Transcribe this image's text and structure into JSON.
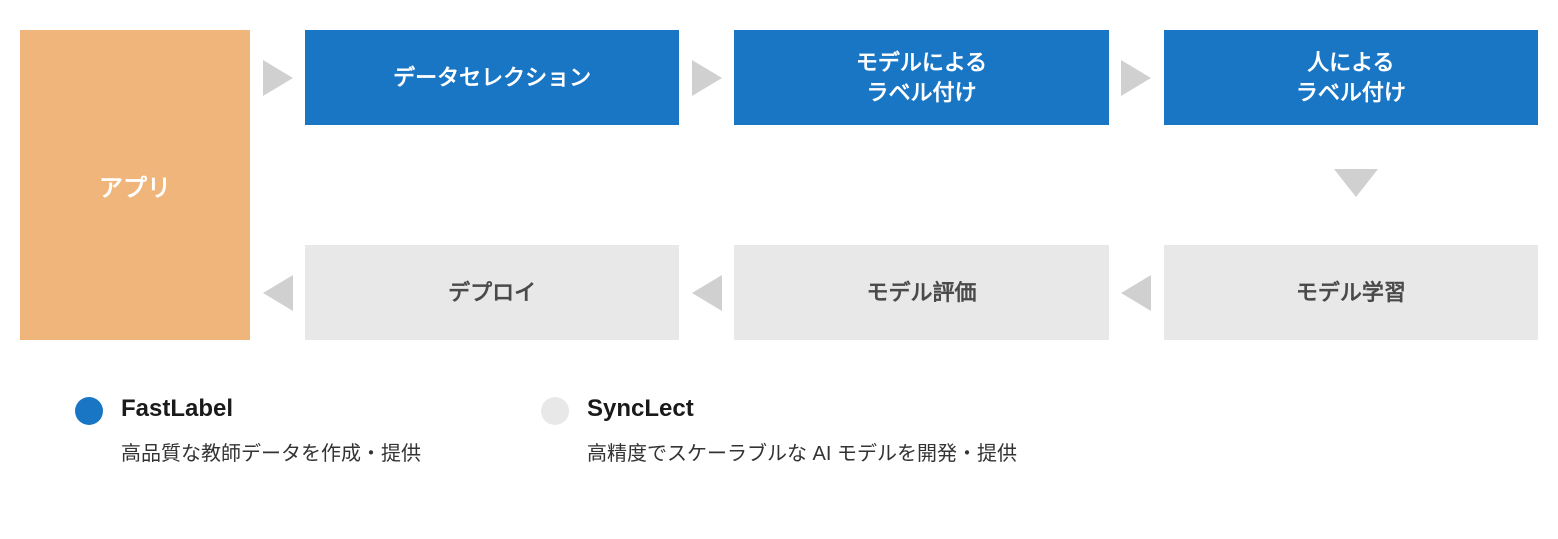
{
  "app": {
    "label": "アプリ"
  },
  "top": {
    "step1": "データセレクション",
    "step2": "モデルによる\nラベル付け",
    "step3": "人による\nラベル付け"
  },
  "bottom": {
    "step1": "デプロイ",
    "step2": "モデル評価",
    "step3": "モデル学習"
  },
  "legend": {
    "fastlabel": {
      "title": "FastLabel",
      "desc": "高品質な教師データを作成・提供"
    },
    "synclect": {
      "title": "SyncLect",
      "desc": "高精度でスケーラブルな AI モデルを開発・提供"
    }
  },
  "colors": {
    "blue": "#1976c5",
    "grey": "#e8e8e8",
    "orange": "#f0b57a"
  }
}
